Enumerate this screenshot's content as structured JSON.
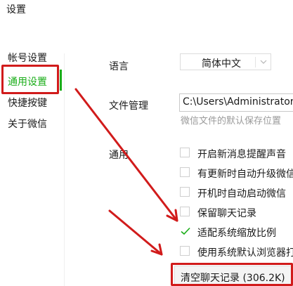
{
  "window": {
    "title": "设置"
  },
  "sidebar": {
    "items": [
      {
        "label": "帐号设置",
        "active": false
      },
      {
        "label": "通用设置",
        "active": true
      },
      {
        "label": "快捷按键",
        "active": false
      },
      {
        "label": "关于微信",
        "active": false
      }
    ]
  },
  "general": {
    "language": {
      "label": "语言",
      "value": "简体中文"
    },
    "file_management": {
      "label": "文件管理",
      "path": "C:\\Users\\Administrator\\",
      "hint": "微信文件的默认保存位置"
    },
    "options": {
      "label": "通用",
      "items": [
        {
          "label": "开启新消息提醒声音",
          "checked": false
        },
        {
          "label": "有更新时自动升级微信",
          "checked": false
        },
        {
          "label": "开机时自动启动微信",
          "checked": false
        },
        {
          "label": "保留聊天记录",
          "checked": false
        },
        {
          "label": "适配系统缩放比例",
          "checked": true
        },
        {
          "label": "使用系统默认浏览器打",
          "checked": false
        }
      ]
    },
    "clear_button": {
      "label": "清空聊天记录 (306.2K)"
    }
  },
  "colors": {
    "accent": "#1aad19",
    "annotation": "#d11b1b"
  },
  "icons": {
    "check": "check-icon",
    "select_arrow": "chevron-down-icon"
  }
}
